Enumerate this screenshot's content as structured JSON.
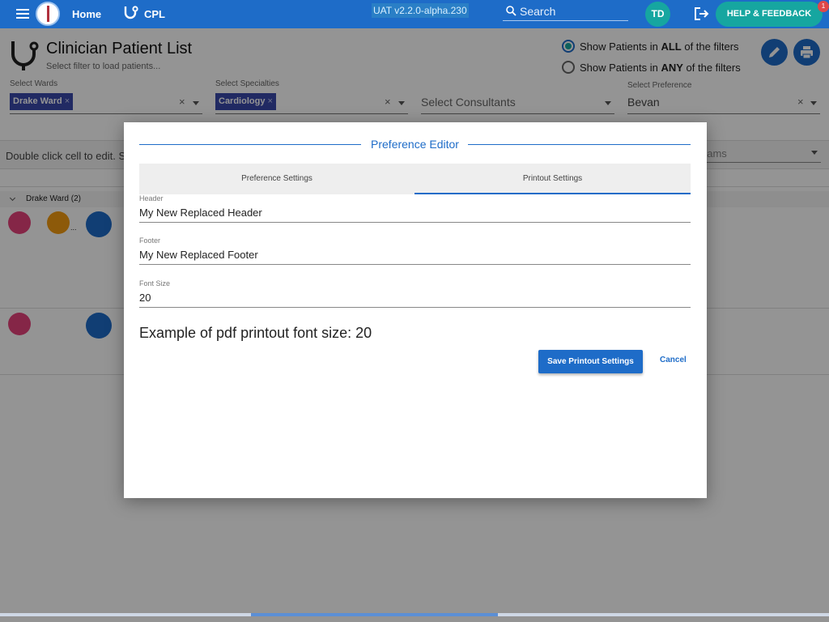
{
  "appbar": {
    "home_label": "Home",
    "app_label": "CPL",
    "version": "UAT v2.2.0-alpha.230",
    "search_placeholder": "Search",
    "avatar_initials": "TD",
    "help_label": "HELP & FEEDBACK",
    "notification_count": "1"
  },
  "header": {
    "title": "Clinician Patient List",
    "subtitle": "Select filter to load patients...",
    "radio_all": {
      "pre": "Show Patients in ",
      "bold": "ALL",
      "post": " of the filters",
      "selected": true
    },
    "radio_any": {
      "pre": "Show Patients in ",
      "bold": "ANY",
      "post": " of the filters",
      "selected": false
    }
  },
  "filters": {
    "wards": {
      "label": "Select Wards",
      "chip": "Drake Ward"
    },
    "specialties": {
      "label": "Select Specialties",
      "chip": "Cardiology"
    },
    "consultants": {
      "placeholder": "Select Consultants"
    },
    "preference": {
      "label": "Select Preference",
      "value": "Bevan"
    }
  },
  "list": {
    "hint": "Double click cell to edit. S",
    "teams_placeholder": "eams",
    "group_label": "Drake Ward (2)",
    "ellipsis": "..."
  },
  "modal": {
    "title": "Preference Editor",
    "tabs": [
      "Preference Settings",
      "Printout Settings"
    ],
    "active_tab": "Printout Settings",
    "fields": {
      "header": {
        "label": "Header",
        "value": "My New Replaced Header"
      },
      "footer": {
        "label": "Footer",
        "value": "My New Replaced Footer"
      },
      "font_size": {
        "label": "Font Size",
        "value": "20"
      }
    },
    "example": "Example of pdf printout font size: 20",
    "save_label": "Save Printout Settings",
    "cancel_label": "Cancel"
  },
  "colors": {
    "primary": "#1e6cc8",
    "teal": "#17a7a0",
    "chip": "#3949ab",
    "female_icon": "#e6427a",
    "orange": "#f39c12"
  }
}
